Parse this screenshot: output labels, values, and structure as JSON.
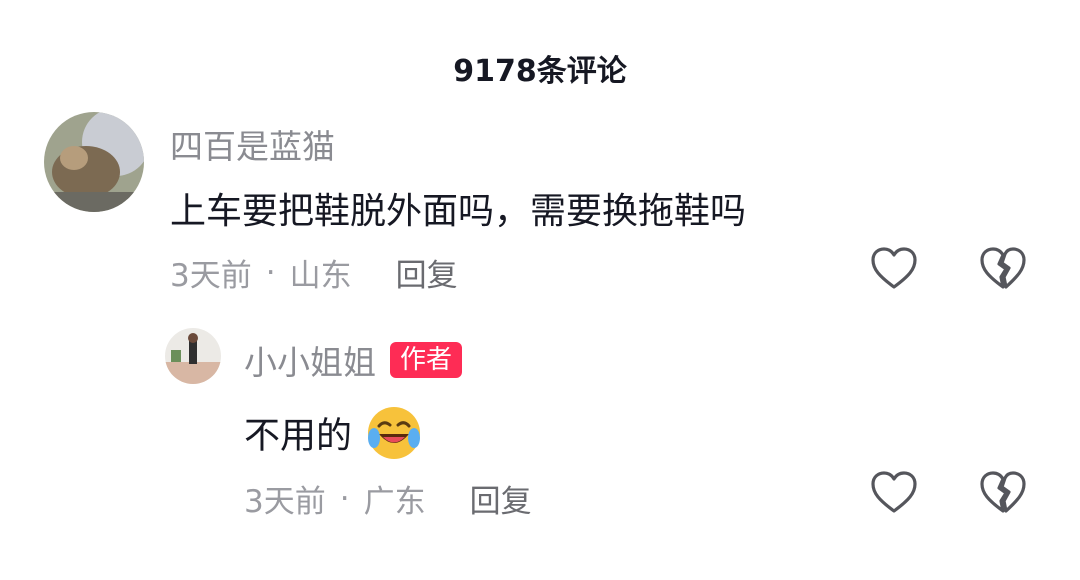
{
  "header": {
    "title": "9178条评论"
  },
  "comments": [
    {
      "username": "四百是蓝猫",
      "text": "上车要把鞋脱外面吗，需要换拖鞋吗",
      "time": "3天前",
      "separator": "·",
      "location": "山东",
      "reply_label": "回复",
      "icons": {
        "like": "heart-outline-icon",
        "dislike": "broken-heart-icon"
      }
    },
    {
      "username": "小小姐姐",
      "badge": "作者",
      "text": "不用的",
      "emoji": "laughing-crying-emoji",
      "time": "3天前",
      "separator": "·",
      "location": "广东",
      "reply_label": "回复",
      "icons": {
        "like": "heart-outline-icon",
        "dislike": "broken-heart-icon"
      }
    }
  ],
  "colors": {
    "badge_bg": "#fe2c55",
    "username": "#8a8b91",
    "meta": "#9a9ba1",
    "text": "#161823"
  }
}
